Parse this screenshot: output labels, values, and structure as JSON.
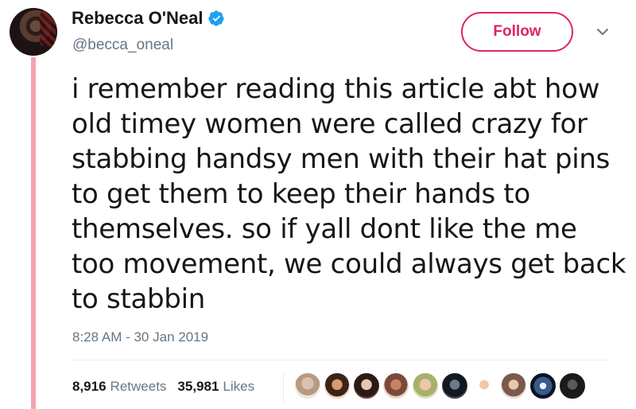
{
  "author": {
    "display_name": "Rebecca O'Neal",
    "handle": "@becca_oneal",
    "verified": true
  },
  "follow_button": {
    "label": "Follow"
  },
  "tweet": {
    "lines": [
      "i remember reading this article abt how",
      "old timey women were called crazy for",
      "stabbing handsy men with their hat pins",
      "to get them to keep their hands to",
      "themselves. so if yall dont like the me",
      "too movement, we could always get back",
      "to stabbin"
    ],
    "timestamp": "8:28 AM - 30 Jan 2019"
  },
  "stats": {
    "retweets_count": "8,916",
    "retweets_label": "Retweets",
    "likes_count": "35,981",
    "likes_label": "Likes"
  },
  "colors": {
    "follow": "#e0245e",
    "verified": "#1da1f2",
    "thread_line": "#f4a3b0",
    "muted": "#657786"
  },
  "icons": {
    "verified": "verified-badge-icon",
    "menu": "chevron-down-icon"
  }
}
